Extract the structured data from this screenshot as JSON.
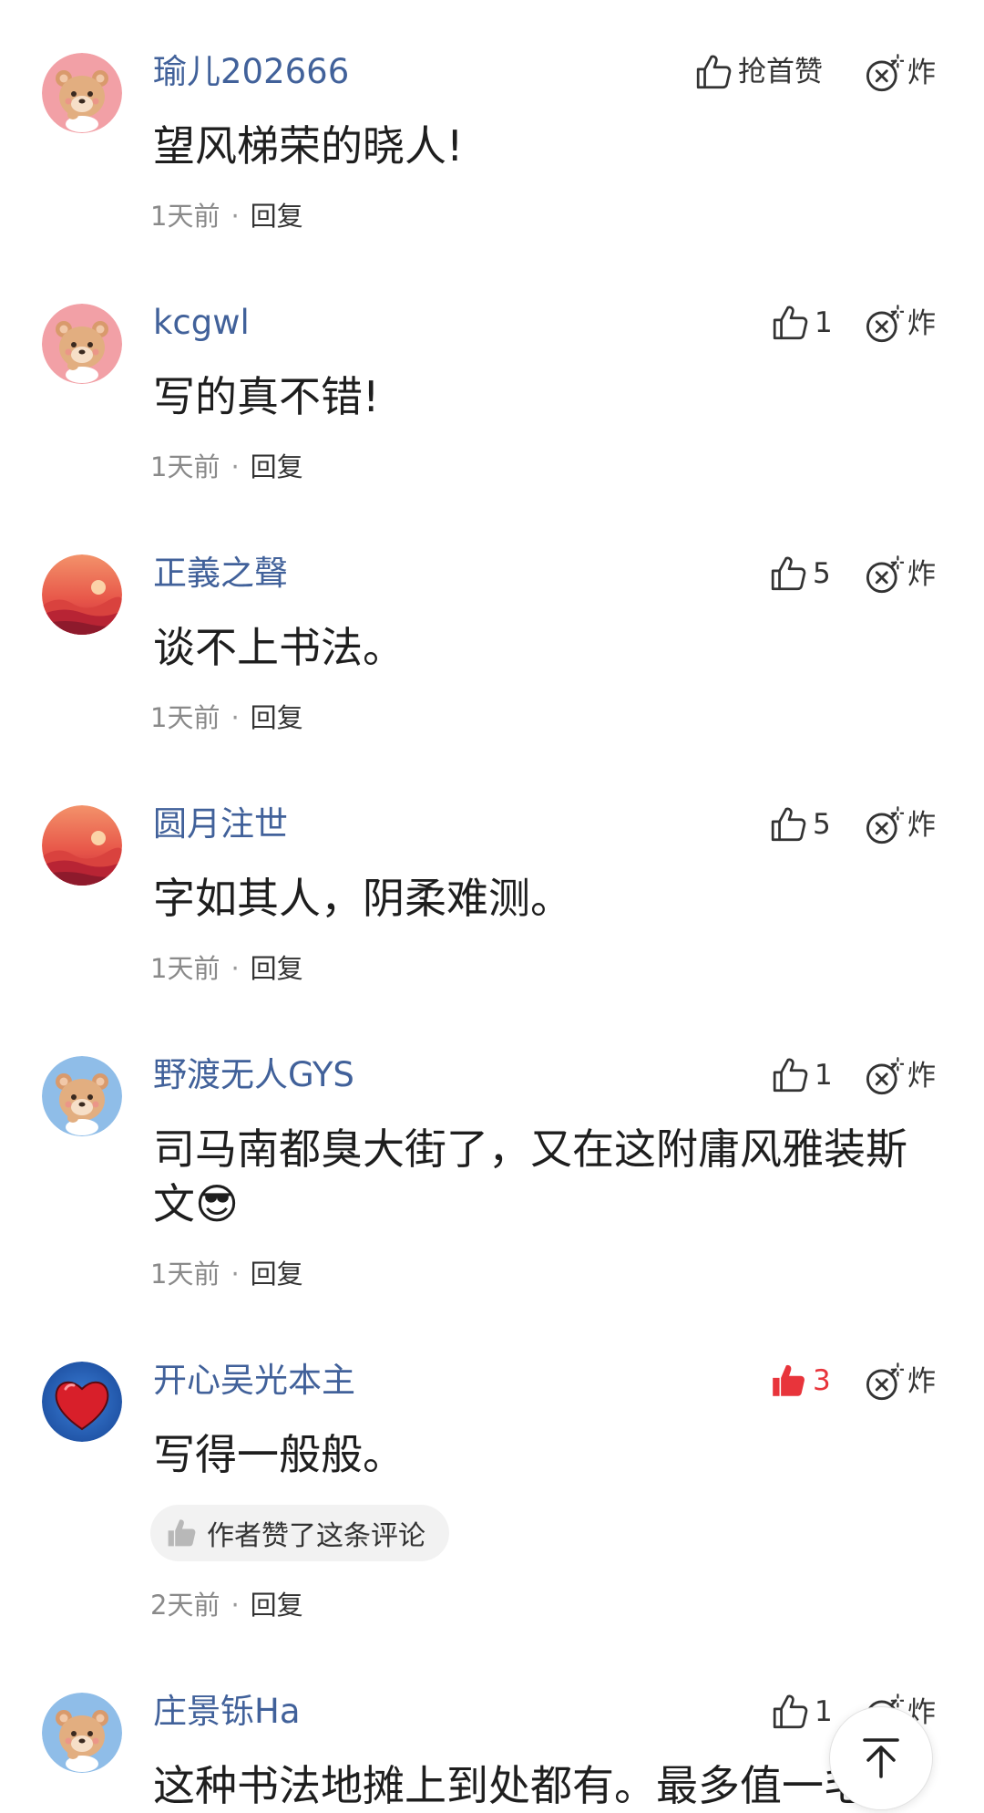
{
  "comments": [
    {
      "username": "瑜儿202666",
      "content": "望风梯荣的晓人!",
      "time": "1天前",
      "reply": "回复",
      "like": "抢首赞",
      "bomb": "炸",
      "avatar": "bear-avatar"
    },
    {
      "username": "kcgwl",
      "content": "写的真不错!",
      "time": "1天前",
      "reply": "回复",
      "like": "1",
      "bomb": "炸",
      "avatar": "bear-avatar"
    },
    {
      "username": "正義之聲",
      "content": "谈不上书法。",
      "time": "1天前",
      "reply": "回复",
      "like": "5",
      "bomb": "炸",
      "avatar": "sunset-avatar"
    },
    {
      "username": "圆月注世",
      "content": "字如其人，阴柔难测。",
      "time": "1天前",
      "reply": "回复",
      "like": "5",
      "bomb": "炸",
      "avatar": "sunset-avatar"
    },
    {
      "username": "野渡无人GYS",
      "content": "司马南都臭大街了，又在这附庸风雅装斯文😎",
      "time": "1天前",
      "reply": "回复",
      "like": "1",
      "bomb": "炸",
      "avatar": "bear-avatar-blue"
    },
    {
      "username": "开心吴光本主",
      "content": "写得一般般。",
      "time": "2天前",
      "reply": "回复",
      "like": "3",
      "liked": true,
      "author_badge": "作者赞了这条评论",
      "bomb": "炸",
      "avatar": "heart-avatar"
    },
    {
      "username": "庄景铄Ha",
      "content": "这种书法地摊上到处都有。最多值一毛",
      "like": "1",
      "bomb": "炸",
      "avatar": "bear-avatar-blue"
    }
  ],
  "colors": {
    "username": "#41619a",
    "liked": "#e8343b",
    "meta": "#8a8a8a"
  },
  "icons": {
    "like": "thumbs-up-icon",
    "bomb": "bomb-icon",
    "top": "back-to-top-icon"
  }
}
